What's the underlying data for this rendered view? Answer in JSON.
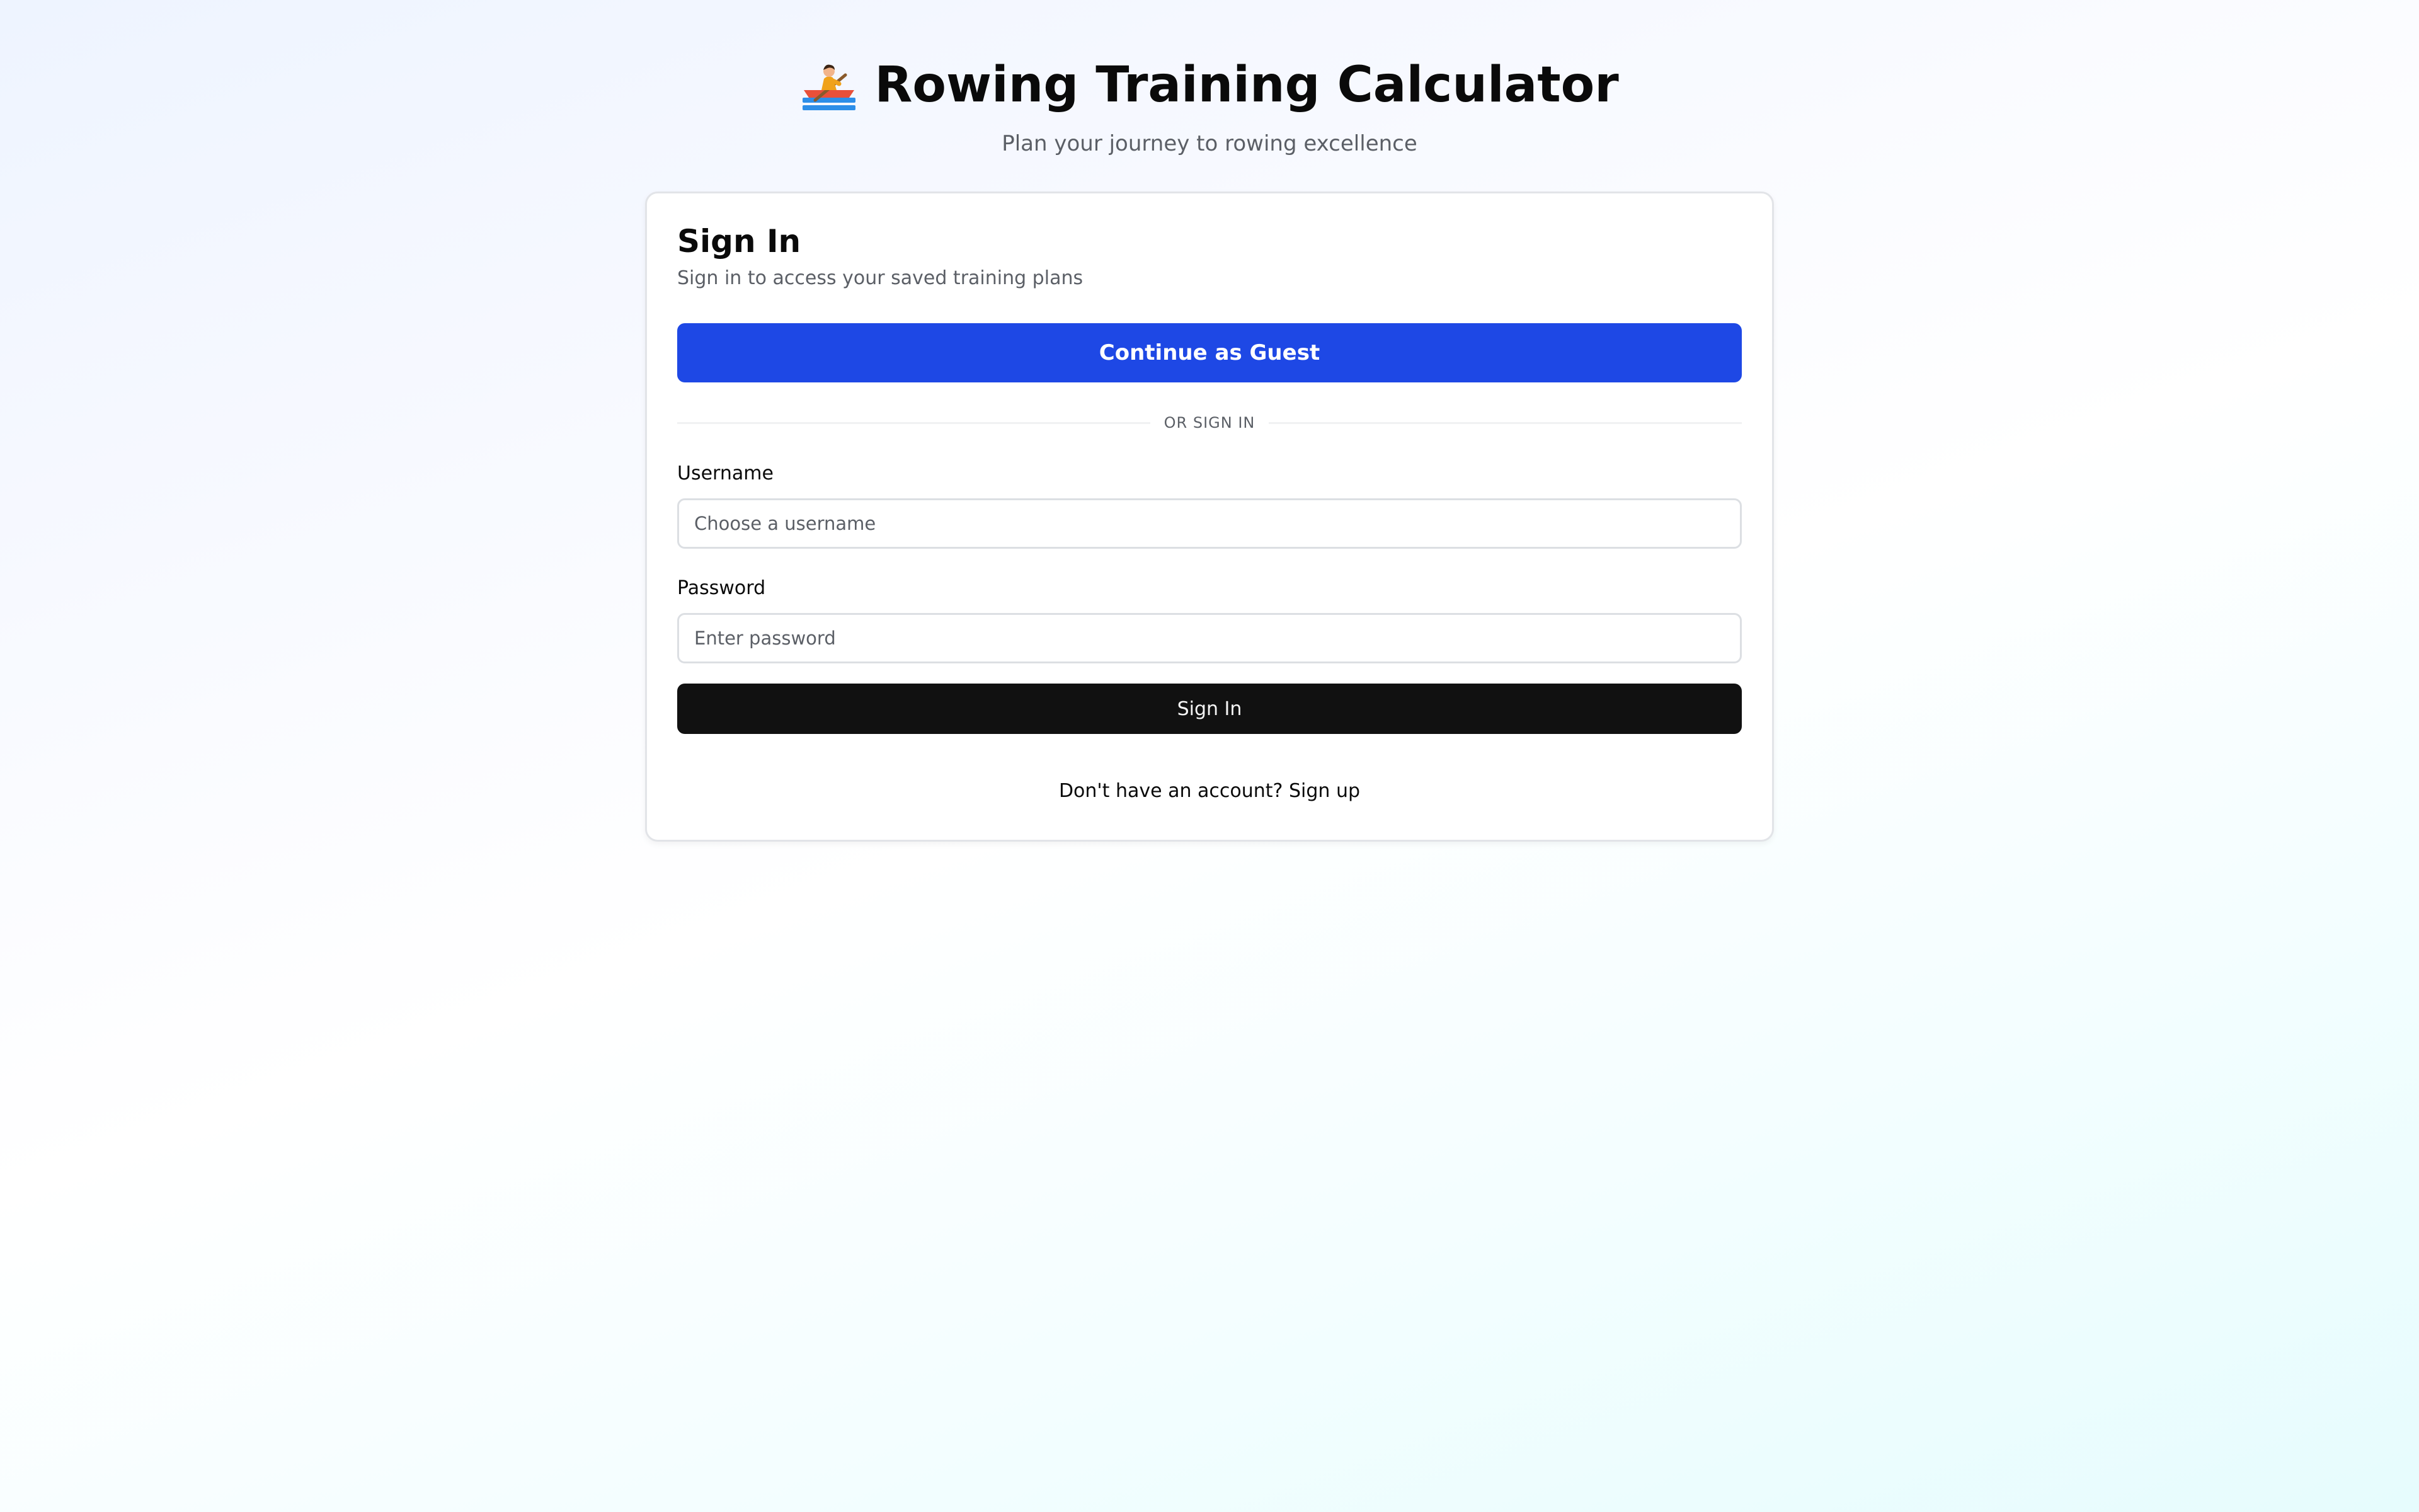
{
  "header": {
    "icon": "rowing-boat-icon",
    "title": "Rowing Training Calculator",
    "subtitle": "Plan your journey to rowing excellence"
  },
  "signin_card": {
    "title": "Sign In",
    "subtitle": "Sign in to access your saved training plans",
    "guest_button_label": "Continue as Guest",
    "divider_text": "OR SIGN IN",
    "username": {
      "label": "Username",
      "placeholder": "Choose a username",
      "value": ""
    },
    "password": {
      "label": "Password",
      "placeholder": "Enter password",
      "value": ""
    },
    "signin_button_label": "Sign In",
    "signup_prompt": "Don't have an account?",
    "signup_link_label": "Sign up"
  },
  "colors": {
    "primary": "#1e48e5",
    "dark_button": "#111111",
    "muted_text": "#5b5f66",
    "border": "#e2e4e8"
  }
}
